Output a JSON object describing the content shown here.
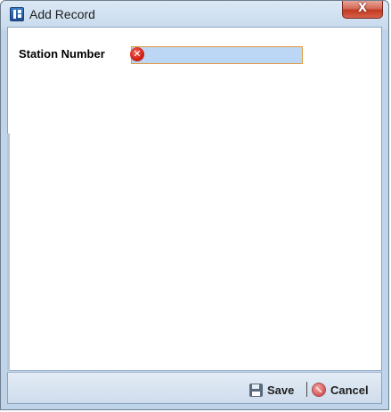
{
  "window": {
    "title": "Add Record",
    "close_glyph": "X"
  },
  "form": {
    "station_number": {
      "label": "Station Number",
      "value": "",
      "error_glyph": "✕"
    }
  },
  "footer": {
    "save_label": "Save",
    "cancel_label": "Cancel"
  },
  "icons": {
    "app": "app-icon",
    "close": "close-icon",
    "error": "error-icon",
    "save": "disk-icon",
    "cancel": "cancel-icon"
  },
  "colors": {
    "titlebar": "#c9dbee",
    "close_button": "#c23a22",
    "input_bg": "#bcd6f5",
    "input_border": "#e19b3d",
    "error": "#d4251a"
  }
}
